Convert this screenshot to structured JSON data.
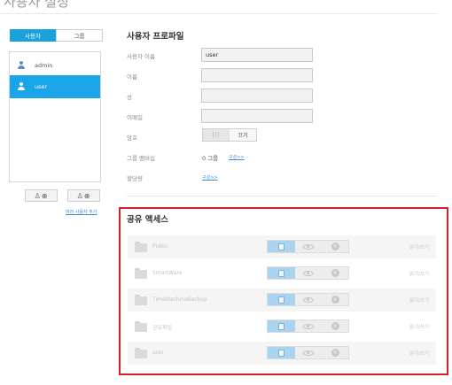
{
  "page": {
    "title": "사용자 설정"
  },
  "sidebar": {
    "tabs": [
      {
        "label": "사용자"
      },
      {
        "label": "그룹"
      }
    ],
    "users": [
      {
        "label": "admin",
        "icon": "admin-user-icon"
      },
      {
        "label": "user",
        "icon": "user-icon"
      }
    ],
    "add_user_icon": "add-user-icon",
    "add_multiple_icon": "add-multiple-users-icon",
    "multi_user_link": "여러 사용자 추가"
  },
  "profile": {
    "title": "사용자 프로파일",
    "username_label": "사용자 이름",
    "username_value": "user",
    "firstname_label": "이름",
    "lastname_label": "성",
    "email_label": "이메일",
    "password_label": "암호",
    "password_toggle_off": "|||",
    "password_toggle_on": "끄기",
    "group_label": "그룹 멤버십",
    "group_value": "0 그룹",
    "group_link": "구성>>",
    "quota_label": "할당량",
    "quota_link": "구성>>"
  },
  "share_access": {
    "title": "공유 액세스",
    "permission_icons": [
      "read-write-icon",
      "read-only-icon",
      "no-access-icon"
    ],
    "rows": [
      {
        "name": "Public",
        "permission": "읽기/쓰기"
      },
      {
        "name": "SmartWare",
        "permission": "읽기/쓰기"
      },
      {
        "name": "TimeMachineBackup",
        "permission": "읽기/쓰기"
      },
      {
        "name": "공유파일",
        "permission": "읽기/쓰기"
      },
      {
        "name": "user",
        "permission": "읽기/쓰기"
      }
    ]
  },
  "colors": {
    "accent": "#1aa0dd",
    "highlight_box": "#d5202c",
    "link": "#3c8cd6"
  }
}
